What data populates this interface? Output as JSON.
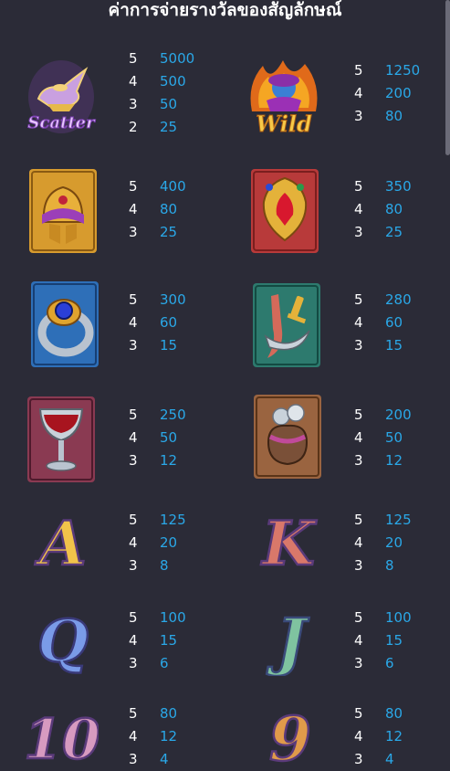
{
  "title": "ค่าการจ่ายรางวัลของสัญลักษณ์",
  "symbols": [
    {
      "icon": "genie-lamp-scatter-icon",
      "label": "Scatter",
      "pays": [
        {
          "count": "5",
          "value": "5000"
        },
        {
          "count": "4",
          "value": "500"
        },
        {
          "count": "3",
          "value": "50"
        },
        {
          "count": "2",
          "value": "25"
        }
      ]
    },
    {
      "icon": "genie-wild-icon",
      "label": "Wild",
      "pays": [
        {
          "count": "5",
          "value": "1250"
        },
        {
          "count": "4",
          "value": "200"
        },
        {
          "count": "3",
          "value": "80"
        }
      ]
    },
    {
      "icon": "turban-helmet-icon",
      "pays": [
        {
          "count": "5",
          "value": "400"
        },
        {
          "count": "4",
          "value": "80"
        },
        {
          "count": "3",
          "value": "25"
        }
      ]
    },
    {
      "icon": "ruby-amulet-icon",
      "pays": [
        {
          "count": "5",
          "value": "350"
        },
        {
          "count": "4",
          "value": "80"
        },
        {
          "count": "3",
          "value": "25"
        }
      ]
    },
    {
      "icon": "sapphire-ring-icon",
      "pays": [
        {
          "count": "5",
          "value": "300"
        },
        {
          "count": "4",
          "value": "60"
        },
        {
          "count": "3",
          "value": "15"
        }
      ]
    },
    {
      "icon": "crossed-daggers-icon",
      "pays": [
        {
          "count": "5",
          "value": "280"
        },
        {
          "count": "4",
          "value": "60"
        },
        {
          "count": "3",
          "value": "15"
        }
      ]
    },
    {
      "icon": "goblet-icon",
      "pays": [
        {
          "count": "5",
          "value": "250"
        },
        {
          "count": "4",
          "value": "50"
        },
        {
          "count": "3",
          "value": "12"
        }
      ]
    },
    {
      "icon": "coin-pouch-icon",
      "pays": [
        {
          "count": "5",
          "value": "200"
        },
        {
          "count": "4",
          "value": "50"
        },
        {
          "count": "3",
          "value": "12"
        }
      ]
    },
    {
      "icon": "letter-a-icon",
      "label": "A",
      "pays": [
        {
          "count": "5",
          "value": "125"
        },
        {
          "count": "4",
          "value": "20"
        },
        {
          "count": "3",
          "value": "8"
        }
      ]
    },
    {
      "icon": "letter-k-icon",
      "label": "K",
      "pays": [
        {
          "count": "5",
          "value": "125"
        },
        {
          "count": "4",
          "value": "20"
        },
        {
          "count": "3",
          "value": "8"
        }
      ]
    },
    {
      "icon": "letter-q-icon",
      "label": "Q",
      "pays": [
        {
          "count": "5",
          "value": "100"
        },
        {
          "count": "4",
          "value": "15"
        },
        {
          "count": "3",
          "value": "6"
        }
      ]
    },
    {
      "icon": "letter-j-icon",
      "label": "J",
      "pays": [
        {
          "count": "5",
          "value": "100"
        },
        {
          "count": "4",
          "value": "15"
        },
        {
          "count": "3",
          "value": "6"
        }
      ]
    },
    {
      "icon": "number-ten-icon",
      "label": "10",
      "pays": [
        {
          "count": "5",
          "value": "80"
        },
        {
          "count": "4",
          "value": "12"
        },
        {
          "count": "3",
          "value": "4"
        }
      ]
    },
    {
      "icon": "number-nine-icon",
      "label": "9",
      "pays": [
        {
          "count": "5",
          "value": "80"
        },
        {
          "count": "4",
          "value": "12"
        },
        {
          "count": "3",
          "value": "4"
        }
      ]
    }
  ]
}
